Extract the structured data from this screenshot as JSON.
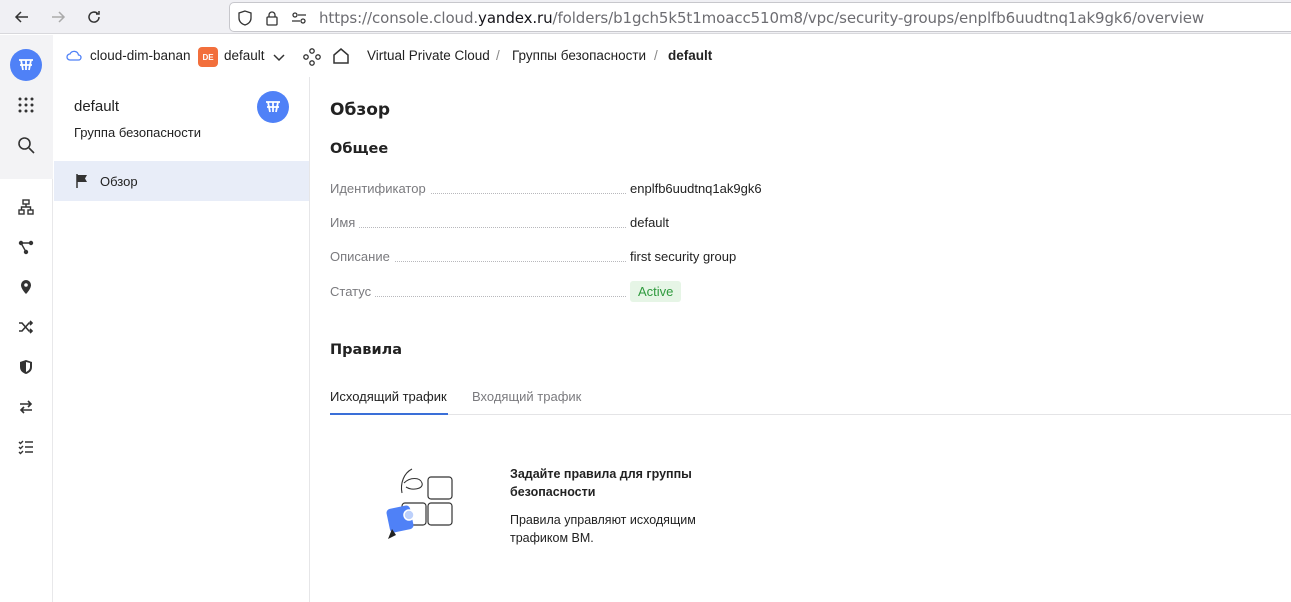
{
  "browser": {
    "url_prefix": "https://console.cloud.",
    "url_host": "yandex.ru",
    "url_path": "/folders/b1gch5k5t1moacc510m8/vpc/security-groups/enplfb6uudtnq1ak9gk6/overview"
  },
  "header": {
    "cloud_name": "cloud-dim-banan",
    "folder_badge": "DE",
    "folder_name": "default",
    "breadcrumbs": [
      "Virtual Private Cloud",
      "Группы безопасности",
      "default"
    ],
    "separator": "/"
  },
  "panel": {
    "title": "default",
    "subtitle": "Группа безопасности",
    "nav_label": "Обзор"
  },
  "main": {
    "title": "Обзор",
    "general_heading": "Общее",
    "properties": [
      {
        "label": "Идентификатор",
        "value": "enplfb6uudtnq1ak9gk6"
      },
      {
        "label": "Имя",
        "value": "default"
      },
      {
        "label": "Описание",
        "value": "first security group"
      },
      {
        "label": "Статус",
        "value": "Active"
      }
    ],
    "rules_heading": "Правила",
    "tabs": [
      "Исходящий трафик",
      "Входящий трафик"
    ],
    "empty_title": "Задайте правила для группы безопасности",
    "empty_text": "Правила управляют исходящим трафиком ВМ."
  },
  "colors": {
    "accent": "#4f81f7",
    "status_active": "#2f9a3e",
    "folder_badge": "#f26f3c"
  }
}
